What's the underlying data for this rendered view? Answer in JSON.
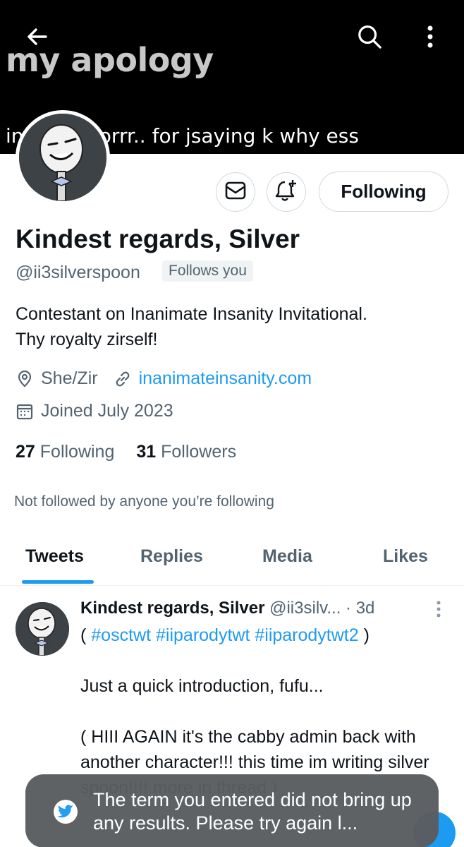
{
  "banner": {
    "title": "my apology",
    "caption": "in    o so soorrr.. for  jsaying k why ess"
  },
  "profile": {
    "name": "Kindest regards, Silver",
    "handle": "@ii3silverspoon",
    "follows_you": "Follows you",
    "bio_line1": "Contestant on Inanimate Insanity Invitational.",
    "bio_line2": "Thy royalty zirself!",
    "pronouns": "She/Zir",
    "website": "inanimateinsanity.com",
    "joined": "Joined July 2023",
    "following_count": "27",
    "following_label": "Following",
    "followers_count": "31",
    "followers_label": "Followers",
    "not_followed": "Not followed by anyone you’re following"
  },
  "actions": {
    "following_button": "Following"
  },
  "tabs": [
    {
      "label": "Tweets"
    },
    {
      "label": "Replies"
    },
    {
      "label": "Media"
    },
    {
      "label": "Likes"
    }
  ],
  "tweet": {
    "name": "Kindest regards, Silver",
    "handle_time": "@ii3silv... · 3d",
    "open_paren": "( ",
    "tag1": "#osctwt",
    "tag2": "#iiparodytwt",
    "tag3": "#iiparodytwt2",
    "close_paren": " )",
    "line2": "Just a quick introduction, fufu...",
    "line3": "( HIII AGAIN it's the cabby admin back with another character!!! this time im writing silver spoon!!!! more in thread )"
  },
  "toast": {
    "text": "The term you entered did not bring up any results. Please try again l..."
  },
  "colors": {
    "accent": "#1d9bf0",
    "secondary_text": "#536471",
    "toast_bg": "#5a5d60"
  }
}
